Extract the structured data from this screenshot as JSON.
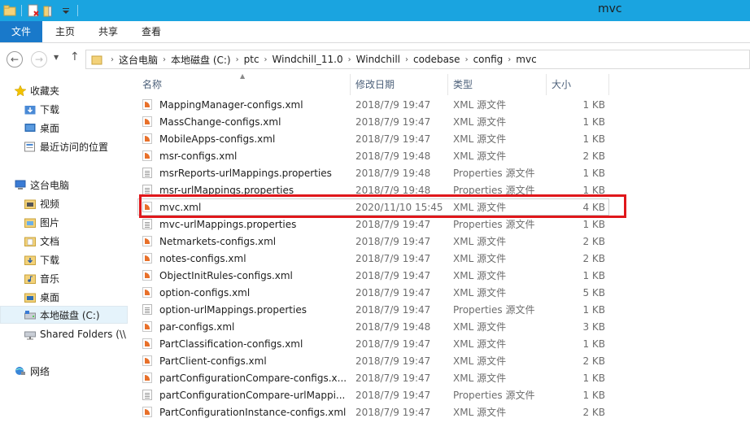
{
  "window": {
    "title": "mvc"
  },
  "ribbon": {
    "tabs": [
      "文件",
      "主页",
      "共享",
      "查看"
    ]
  },
  "address": {
    "breadcrumbs": [
      "这台电脑",
      "本地磁盘 (C:)",
      "ptc",
      "Windchill_11.0",
      "Windchill",
      "codebase",
      "config",
      "mvc"
    ]
  },
  "nav": {
    "favorites_label": "收藏夹",
    "favorites": [
      "下载",
      "桌面",
      "最近访问的位置"
    ],
    "thispc_label": "这台电脑",
    "thispc": [
      "视频",
      "图片",
      "文档",
      "下载",
      "音乐",
      "桌面",
      "本地磁盘 (C:)",
      "Shared Folders (\\\\"
    ],
    "network_label": "网络"
  },
  "columns": {
    "name": "名称",
    "date": "修改日期",
    "type": "类型",
    "size": "大小"
  },
  "files": [
    {
      "name": "MappingManager-configs.xml",
      "date": "2018/7/9 19:47",
      "type": "XML 源文件",
      "size": "1 KB",
      "kind": "xml"
    },
    {
      "name": "MassChange-configs.xml",
      "date": "2018/7/9 19:47",
      "type": "XML 源文件",
      "size": "1 KB",
      "kind": "xml"
    },
    {
      "name": "MobileApps-configs.xml",
      "date": "2018/7/9 19:47",
      "type": "XML 源文件",
      "size": "1 KB",
      "kind": "xml"
    },
    {
      "name": "msr-configs.xml",
      "date": "2018/7/9 19:48",
      "type": "XML 源文件",
      "size": "2 KB",
      "kind": "xml"
    },
    {
      "name": "msrReports-urlMappings.properties",
      "date": "2018/7/9 19:48",
      "type": "Properties 源文件",
      "size": "1 KB",
      "kind": "prop"
    },
    {
      "name": "msr-urlMappings.properties",
      "date": "2018/7/9 19:48",
      "type": "Properties 源文件",
      "size": "1 KB",
      "kind": "prop"
    },
    {
      "name": "mvc.xml",
      "date": "2020/11/10 15:45",
      "type": "XML 源文件",
      "size": "4 KB",
      "kind": "xml"
    },
    {
      "name": "mvc-urlMappings.properties",
      "date": "2018/7/9 19:47",
      "type": "Properties 源文件",
      "size": "1 KB",
      "kind": "prop"
    },
    {
      "name": "Netmarkets-configs.xml",
      "date": "2018/7/9 19:47",
      "type": "XML 源文件",
      "size": "2 KB",
      "kind": "xml"
    },
    {
      "name": "notes-configs.xml",
      "date": "2018/7/9 19:47",
      "type": "XML 源文件",
      "size": "2 KB",
      "kind": "xml"
    },
    {
      "name": "ObjectInitRules-configs.xml",
      "date": "2018/7/9 19:47",
      "type": "XML 源文件",
      "size": "1 KB",
      "kind": "xml"
    },
    {
      "name": "option-configs.xml",
      "date": "2018/7/9 19:47",
      "type": "XML 源文件",
      "size": "5 KB",
      "kind": "xml"
    },
    {
      "name": "option-urlMappings.properties",
      "date": "2018/7/9 19:47",
      "type": "Properties 源文件",
      "size": "1 KB",
      "kind": "prop"
    },
    {
      "name": "par-configs.xml",
      "date": "2018/7/9 19:48",
      "type": "XML 源文件",
      "size": "3 KB",
      "kind": "xml"
    },
    {
      "name": "PartClassification-configs.xml",
      "date": "2018/7/9 19:47",
      "type": "XML 源文件",
      "size": "1 KB",
      "kind": "xml"
    },
    {
      "name": "PartClient-configs.xml",
      "date": "2018/7/9 19:47",
      "type": "XML 源文件",
      "size": "2 KB",
      "kind": "xml"
    },
    {
      "name": "partConfigurationCompare-configs.x...",
      "date": "2018/7/9 19:47",
      "type": "XML 源文件",
      "size": "1 KB",
      "kind": "xml"
    },
    {
      "name": "partConfigurationCompare-urlMappi...",
      "date": "2018/7/9 19:47",
      "type": "Properties 源文件",
      "size": "1 KB",
      "kind": "prop"
    },
    {
      "name": "PartConfigurationInstance-configs.xml",
      "date": "2018/7/9 19:47",
      "type": "XML 源文件",
      "size": "2 KB",
      "kind": "xml"
    }
  ],
  "colors": {
    "titlebar": "#1aa4e0",
    "file_tab": "#1979ca",
    "highlight_box": "#e0171b"
  },
  "icons": {
    "folder": "folder-icon",
    "xml": "xml-file-icon",
    "properties": "properties-file-icon"
  }
}
